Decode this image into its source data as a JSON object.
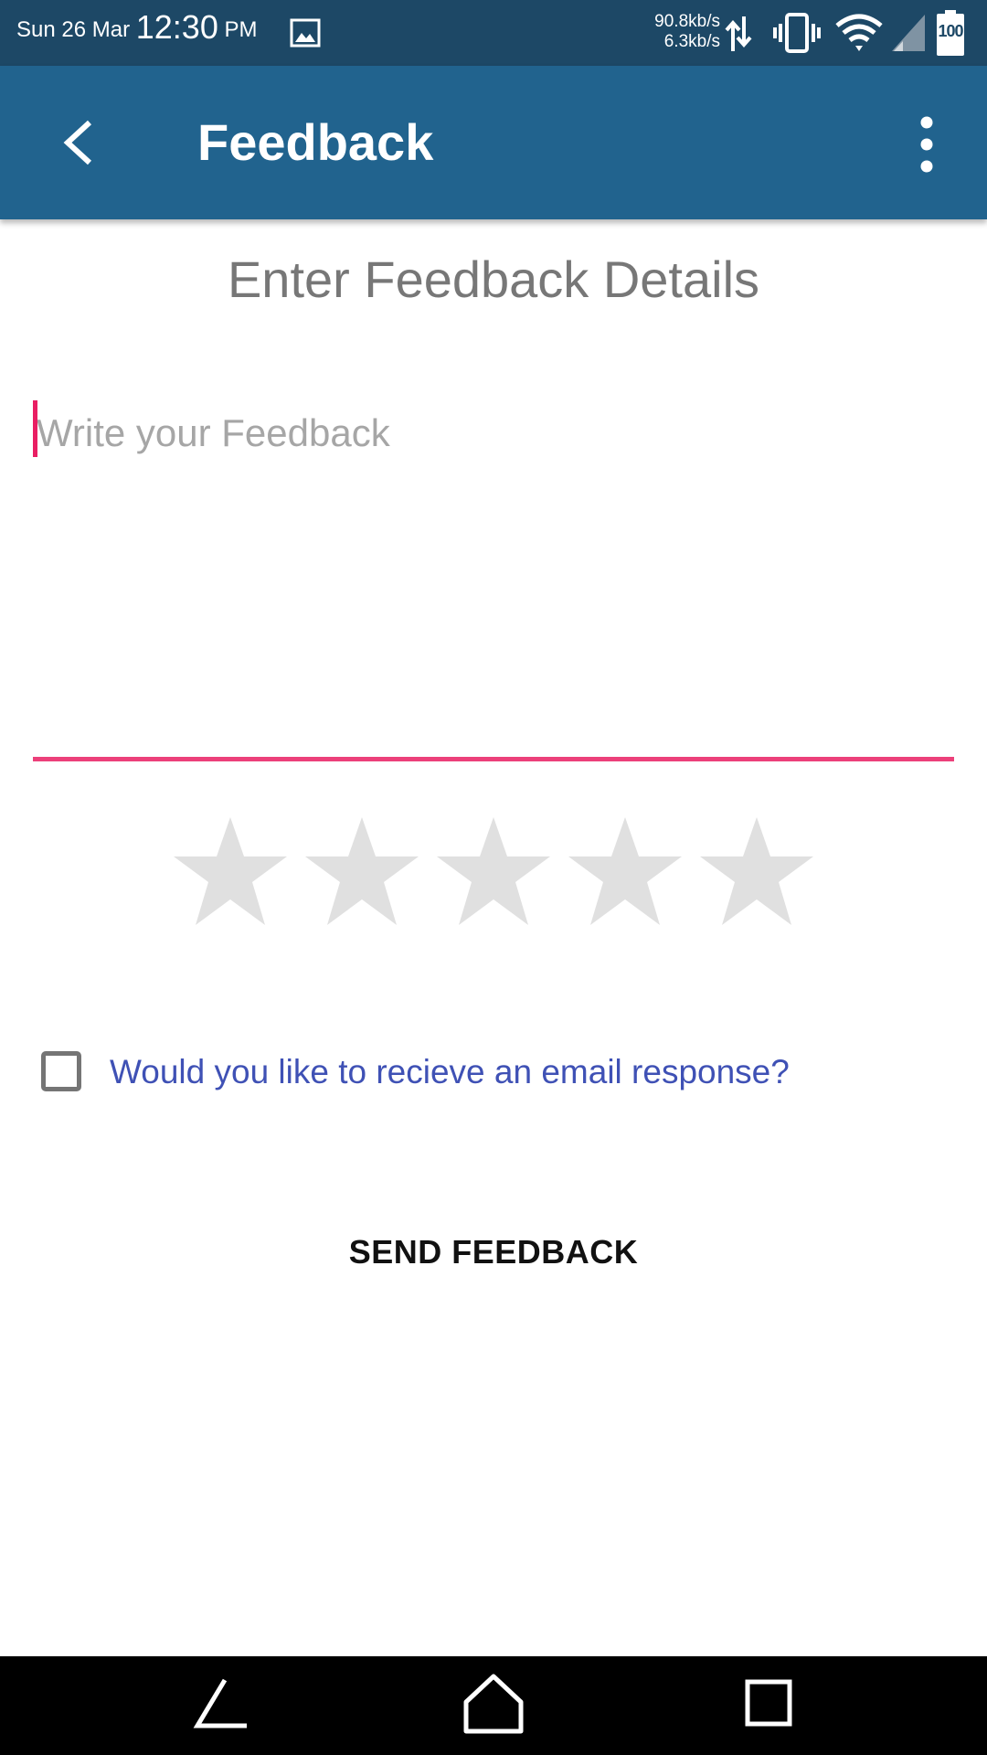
{
  "status_bar": {
    "date": "Sun 26 Mar",
    "time": "12:30",
    "ampm": "PM",
    "download_speed": "90.8kb/s",
    "upload_speed": "6.3kb/s",
    "battery": "100",
    "icons": [
      "gallery-icon",
      "data-arrows-icon",
      "vibrate-icon",
      "wifi-icon",
      "signal-icon",
      "battery-icon"
    ]
  },
  "app_bar": {
    "title": "Feedback",
    "back_icon": "chevron-left-icon",
    "menu_icon": "more-vert-icon",
    "background": "#21638e"
  },
  "form": {
    "heading": "Enter Feedback Details",
    "feedback_value": "",
    "feedback_placeholder": "Write your Feedback",
    "accent_color": "#ec407a",
    "rating": {
      "value": 0,
      "max": 5
    },
    "email_checkbox": {
      "checked": false,
      "label": "Would you like to recieve an email response?"
    },
    "send_label": "SEND FEEDBACK"
  },
  "nav_bar": {
    "icons": [
      "nav-back-icon",
      "nav-home-icon",
      "nav-recents-icon"
    ]
  }
}
